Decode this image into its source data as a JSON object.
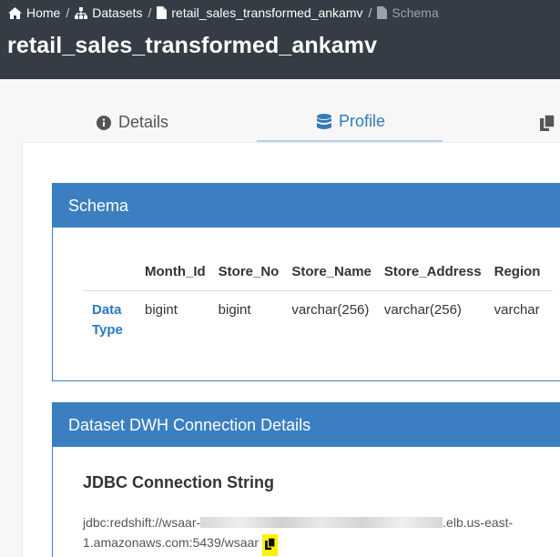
{
  "breadcrumb": {
    "home": "Home",
    "datasets": "Datasets",
    "dataset": "retail_sales_transformed_ankamv",
    "current": "Schema",
    "separator": "/"
  },
  "page_title": "retail_sales_transformed_ankamv",
  "tabs": {
    "details": "Details",
    "profile": "Profile"
  },
  "schema_panel": {
    "title": "Schema",
    "columns": [
      "Month_Id",
      "Store_No",
      "Store_Name",
      "Store_Address",
      "Region"
    ],
    "row_label_line1": "Data",
    "row_label_line2": "Type",
    "types": [
      "bigint",
      "bigint",
      "varchar(256)",
      "varchar(256)",
      "varchar"
    ]
  },
  "dwh_panel": {
    "title": "Dataset DWH Connection Details",
    "jdbc_title": "JDBC Connection String",
    "jdbc_prefix": "jdbc:redshift://wsaar-",
    "jdbc_suffix": ".elb.us-east-1.amazonaws.com:5439/wsaar"
  },
  "icons": {
    "home": "home-icon",
    "datasets": "sitemap-icon",
    "file": "file-icon",
    "info": "info-circle-icon",
    "database": "database-icon",
    "copy": "copy-icon"
  },
  "colors": {
    "header_bg": "#353c45",
    "accent": "#337ab7",
    "panel_head": "#3b7fc0",
    "highlight": "#fff200"
  }
}
